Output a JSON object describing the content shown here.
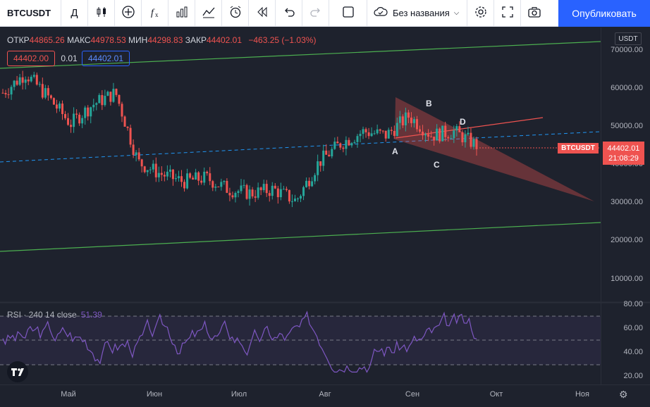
{
  "toolbar": {
    "symbol": "BTCUSDT",
    "interval": "Д",
    "layout_name": "Без названия",
    "publish_label": "Опубликовать"
  },
  "legend": {
    "open_label": "ОТКР",
    "open": "44865.26",
    "high_label": "МАКС",
    "high": "44978.53",
    "low_label": "МИН",
    "low": "44298.83",
    "close_label": "ЗАКР",
    "close": "44402.01",
    "change": "−463.25 (−1.03%)"
  },
  "trade": {
    "sell": "44402.00",
    "spread": "0.01",
    "buy": "44402.01"
  },
  "price_axis": {
    "currency": "USDT",
    "ticks": [
      "70000.00",
      "60000.00",
      "50000.00",
      "40000.00",
      "30000.00",
      "20000.00",
      "10000.00"
    ],
    "symbol_tag": "BTCUSDT",
    "last_price": "44402.01",
    "countdown": "21:08:29"
  },
  "rsi": {
    "label": "RSI · 240 14 close",
    "value": "51.39",
    "ticks": [
      "80.00",
      "60.00",
      "40.00",
      "20.00"
    ]
  },
  "time_axis": [
    "Май",
    "Июн",
    "Июл",
    "Авг",
    "Сен",
    "Окт",
    "Ноя"
  ],
  "pattern_points": [
    "A",
    "B",
    "C",
    "D"
  ],
  "colors": {
    "up": "#26a69a",
    "down": "#ef5350",
    "accent": "#2962ff",
    "rsi": "#7e57c2",
    "channel": "#4caf50"
  },
  "chart_data": {
    "type": "candlestick",
    "series_name": "BTCUSDT",
    "price_range": [
      0,
      75000
    ],
    "x_labels": [
      "Май",
      "Июн",
      "Июл",
      "Авг",
      "Сен",
      "Окт",
      "Ноя"
    ],
    "approx_closes": [
      58000,
      63000,
      57000,
      50000,
      55000,
      58000,
      40000,
      37000,
      35000,
      36000,
      33000,
      32000,
      33000,
      30000,
      40000,
      45000,
      48000,
      47000,
      52000,
      47000,
      48000,
      44402
    ],
    "last_price": 44402.01,
    "rsi_range": [
      20,
      80
    ],
    "rsi_last": 51.39
  }
}
